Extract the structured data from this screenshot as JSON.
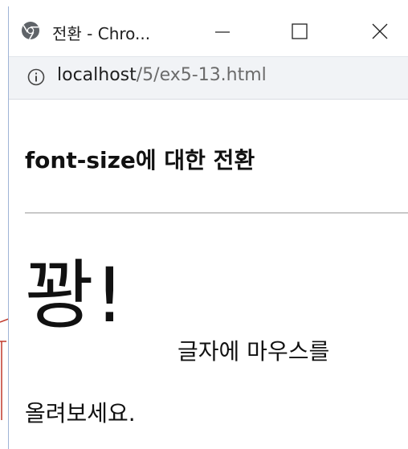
{
  "window": {
    "tab_title": "전환 - Chro...",
    "icons": {
      "browser": "chrome-icon",
      "minimize": "minimize-icon",
      "maximize": "maximize-icon",
      "close": "close-icon",
      "info": "info-icon"
    }
  },
  "address_bar": {
    "host": "localhost",
    "path": "/5/ex5-13.html"
  },
  "page": {
    "heading": "font-size에 대한 전환",
    "big_word": "꽝!",
    "hint_line1": "글자에 마우스를",
    "hint_line2": "올려보세요."
  },
  "colors": {
    "annotation": "#c0392b",
    "addressbar_bg": "#f1f3f6",
    "divider": "#c8c8c8"
  }
}
